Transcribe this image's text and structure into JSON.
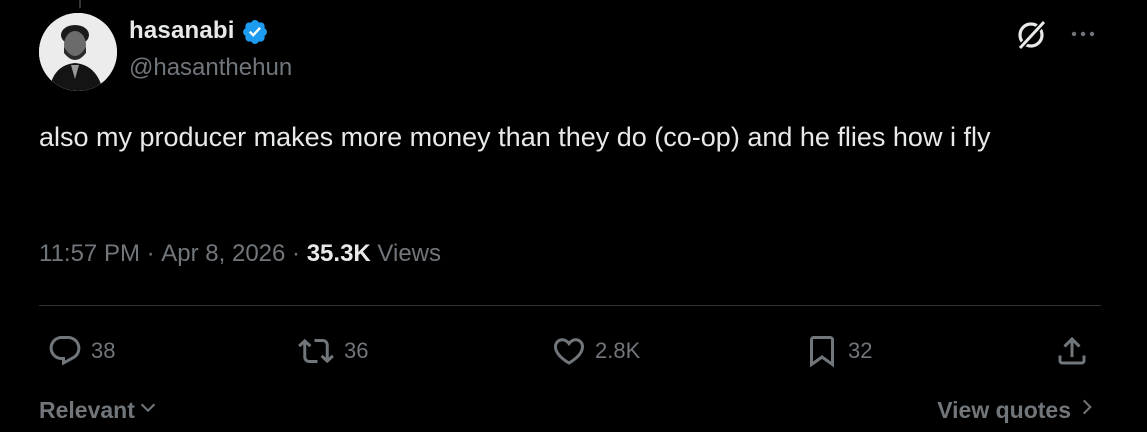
{
  "author": {
    "display_name": "hasanabi",
    "handle": "@hasanthehun",
    "verified": true,
    "verified_color": "#1d9bf0"
  },
  "header_icons": {
    "grok": "grok-icon",
    "more": "more-icon"
  },
  "tweet": {
    "text": "also my producer makes more money than they do (co-op) and he flies how i fly"
  },
  "meta": {
    "time": "11:57 PM",
    "separator1": " · ",
    "date": "Apr 8, 2026",
    "separator2": " · ",
    "views_count": "35.3K",
    "views_label": " Views"
  },
  "actions": {
    "replies": "38",
    "reposts": "36",
    "likes": "2.8K",
    "bookmarks": "32"
  },
  "footer": {
    "sort_label": "Relevant",
    "view_quotes_label": "View quotes"
  },
  "colors": {
    "background": "#000000",
    "text_primary": "#e7e9ea",
    "text_secondary": "#71767b",
    "divider": "#2f3336"
  }
}
